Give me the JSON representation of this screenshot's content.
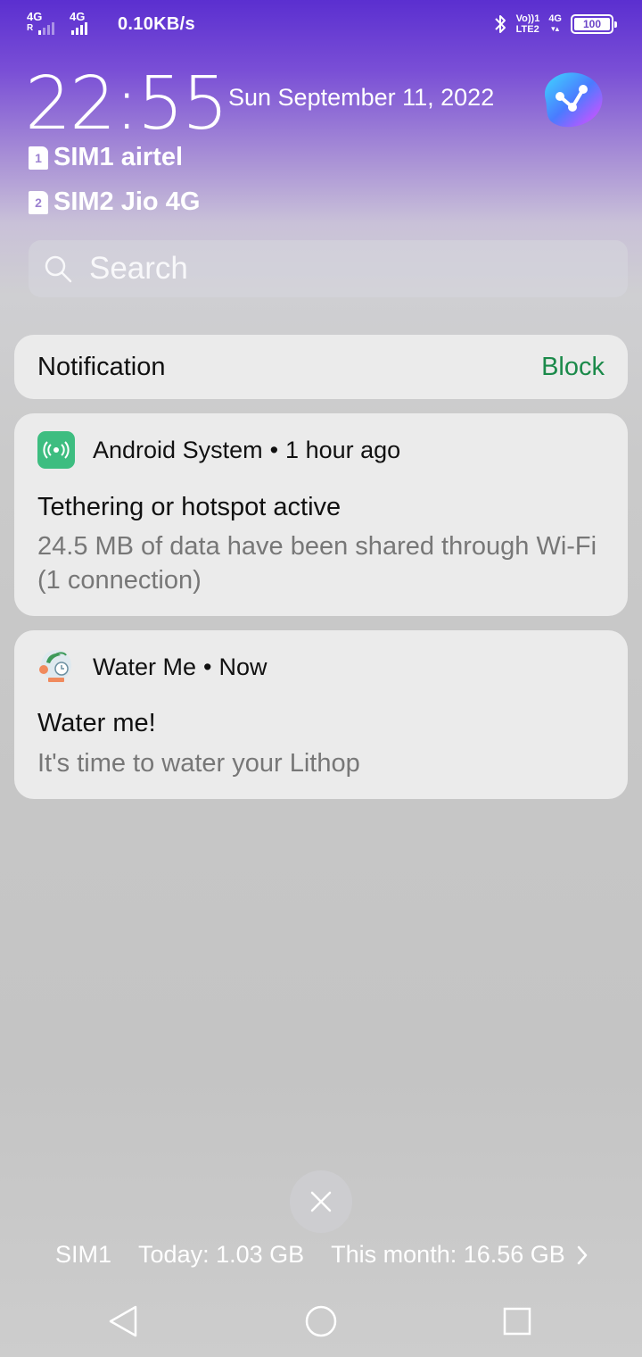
{
  "status_bar": {
    "network1": {
      "type": "4G",
      "sub": "R"
    },
    "network2": {
      "type": "4G"
    },
    "speed": "0.10KB/s",
    "volte_top": "Vo))1",
    "volte_bottom": "LTE2",
    "network_right": "4G",
    "battery": "100",
    "icons": [
      "signal-icon",
      "bluetooth-icon",
      "battery-icon"
    ]
  },
  "lockscreen": {
    "time": "22:55",
    "date": "Sun September 11, 2022",
    "sim1": {
      "num": "1",
      "label": "SIM1 airtel"
    },
    "sim2": {
      "num": "2",
      "label": "SIM2 Jio 4G"
    }
  },
  "search": {
    "placeholder": "Search"
  },
  "notification_header": {
    "title": "Notification",
    "action": "Block"
  },
  "notifications": [
    {
      "app": "Android System",
      "time": "1 hour ago",
      "title": "Tethering or hotspot active",
      "body": "24.5 MB of data have been shared through Wi-Fi (1 connection)",
      "icon": "hotspot-icon"
    },
    {
      "app": "Water Me",
      "time": "Now",
      "title": "Water me!",
      "body": "It's time to water your Lithop",
      "icon": "plant-icon"
    }
  ],
  "data_usage": {
    "sim": "SIM1",
    "today": "Today: 1.03 GB",
    "month": "This month: 16.56 GB"
  },
  "colors": {
    "accent": "#5b2fd0",
    "block": "#1b8a4a",
    "system_icon": "#3dbd80"
  }
}
